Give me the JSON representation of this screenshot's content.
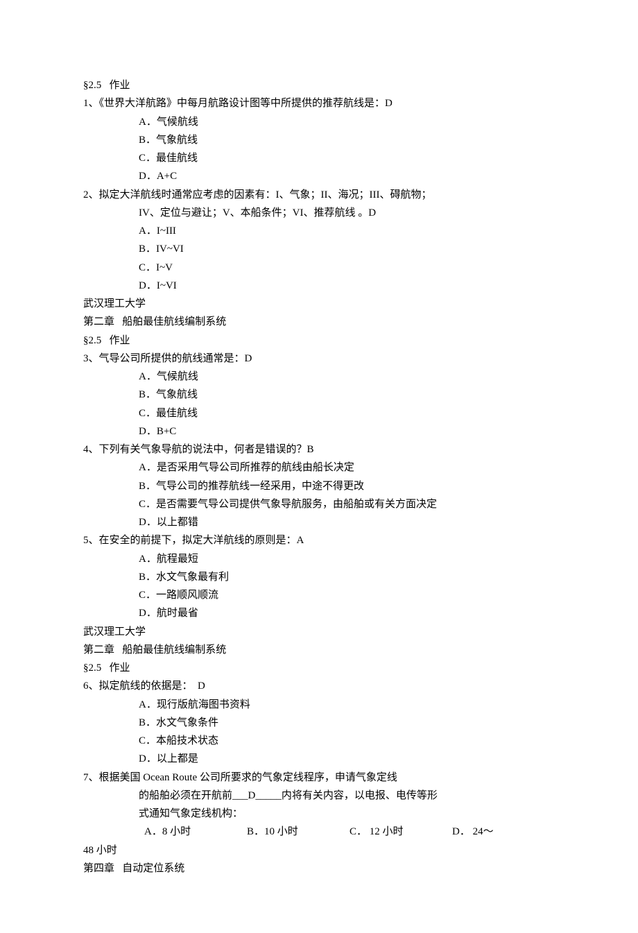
{
  "section1": {
    "heading": "§2.5   作业",
    "q1": {
      "text": "1、《世界大洋航路》中每月航路设计图等中所提供的推荐航线是：D",
      "a": "A．气候航线",
      "b": "B．气象航线",
      "c": "C．最佳航线",
      "d": "D．A+C"
    },
    "q2": {
      "text": "2、拟定大洋航线时通常应考虑的因素有：I、气象；II、海况；III、碍航物；",
      "cont": "IV、定位与避让；V、本船条件；VI、推荐航线 。D",
      "a": "A．I~III",
      "b": "B．IV~VI",
      "c": "C．I~V",
      "d": "D．I~VI"
    }
  },
  "section2": {
    "uni": "武汉理工大学",
    "chapter": "第二章   船舶最佳航线编制系统",
    "heading": "§2.5   作业",
    "q3": {
      "text": "3、气导公司所提供的航线通常是：D",
      "a": "A．气候航线",
      "b": "B．气象航线",
      "c": "C．最佳航线",
      "d": "D．B+C"
    },
    "q4": {
      "text": "4、下列有关气象导航的说法中，何者是错误的？B",
      "a": "A．是否采用气导公司所推荐的航线由船长决定",
      "b": "B．气导公司的推荐航线一经采用，中途不得更改",
      "c": "C．是否需要气导公司提供气象导航服务，由船舶或有关方面决定",
      "d": "D．以上都错"
    },
    "q5": {
      "text": "5、在安全的前提下，拟定大洋航线的原则是：A",
      "a": "A．航程最短",
      "b": "B．水文气象最有利",
      "c": "C．一路顺风顺流",
      "d": "D．航时最省"
    }
  },
  "section3": {
    "uni": "武汉理工大学",
    "chapter": "第二章   船舶最佳航线编制系统",
    "heading": "§2.5   作业",
    "q6": {
      "text": "6、拟定航线的依据是：  D",
      "a": "A．现行版航海图书资料",
      "b": "B．水文气象条件",
      "c": "C．本船技术状态",
      "d": "D．以上都是"
    },
    "q7": {
      "text": "7、根据美国 Ocean Route 公司所要求的气象定线程序，申请气象定线",
      "cont1": "的船舶必须在开航前___D_____内将有关内容，以电报、电传等形",
      "cont2": "式通知气象定线机构：",
      "a": "A．8 小时",
      "b": "B．10 小时",
      "c": "C．  12 小时",
      "d": "D．  24～",
      "dcont": "48 小时"
    }
  },
  "chapter4": "第四章   自动定位系统"
}
